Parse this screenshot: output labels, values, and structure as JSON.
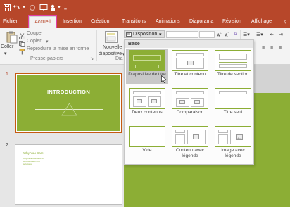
{
  "colors": {
    "brand": "#b7472a",
    "accent_green": "#8cae35",
    "focus_outline": "#e03fa4",
    "slide_border": "#c55a11"
  },
  "quick_access": {
    "save_icon": "save-icon",
    "undo_icon": "undo-icon",
    "redo_icon": "redo-icon",
    "present_icon": "start-from-beginning-icon",
    "customize_icon": "customize-qat-icon"
  },
  "tabs": [
    {
      "label": "Fichier"
    },
    {
      "label": "Accueil"
    },
    {
      "label": "Insertion"
    },
    {
      "label": "Création"
    },
    {
      "label": "Transitions"
    },
    {
      "label": "Animations"
    },
    {
      "label": "Diaporama"
    },
    {
      "label": "Révision"
    },
    {
      "label": "Affichage"
    }
  ],
  "ribbon": {
    "clipboard": {
      "paste_label": "Coller",
      "cut_label": "Couper",
      "copy_label": "Copier",
      "format_painter_label": "Reproduire la mise en forme",
      "group_label": "Presse-papiers"
    },
    "slides": {
      "new_slide_line1": "Nouvelle",
      "new_slide_line2": "diapositive",
      "layout_label": "Disposition",
      "group_label_partial": "Dia"
    }
  },
  "layout_menu": {
    "header": "Base",
    "items": [
      {
        "label": "Diapositive de titre",
        "selected": true
      },
      {
        "label": "Titre et contenu"
      },
      {
        "label": "Titre de section"
      },
      {
        "label": "Deux contenus"
      },
      {
        "label": "Comparaison"
      },
      {
        "label": "Titre seul"
      },
      {
        "label": "Vide"
      },
      {
        "label_line1": "Contenu avec",
        "label_line2": "légende"
      },
      {
        "label_line1": "Image avec",
        "label_line2": "légende"
      }
    ]
  },
  "slides": [
    {
      "number": "1",
      "title": "INTRODUCTION"
    },
    {
      "number": "2",
      "title": "Why You Care",
      "body_lines": [
        "Cognitive overload on",
        "vertical users and",
        "solutions"
      ]
    }
  ]
}
